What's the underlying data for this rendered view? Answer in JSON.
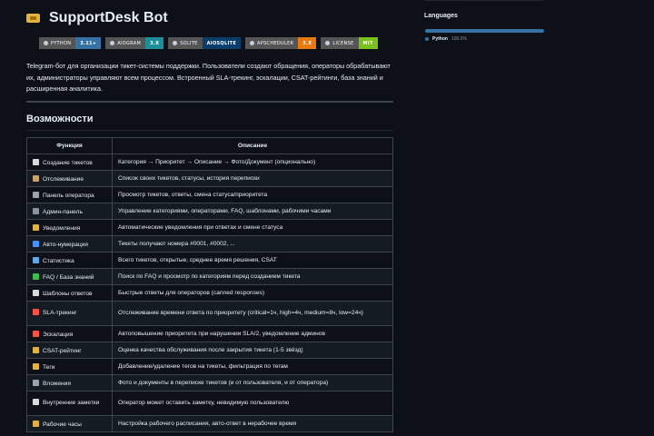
{
  "title": "SupportDesk Bot",
  "badges": [
    {
      "label": "PYTHON",
      "value": "3.11+",
      "color": "#3572A5"
    },
    {
      "label": "AIOGRAM",
      "value": "3.X",
      "color": "#1e8e9a"
    },
    {
      "label": "SQLITE",
      "value": "AIOSQLITE",
      "color": "#0b3d6b"
    },
    {
      "label": "APSCHEDULER",
      "value": "3.X",
      "color": "#e8790f"
    },
    {
      "label": "LICENSE",
      "value": "MIT",
      "color": "#79c11c"
    }
  ],
  "description": "Telegram-бот для организации тикет-системы поддержки. Пользователи создают обращения, операторы обрабатывают их, администраторы управляют всем процессом. Встроенный SLA-трекинг, эскалации, CSAT-рейтинги, база знаний и расширенная аналитика.",
  "features_heading": "Возможности",
  "table": {
    "headers": [
      "Функция",
      "Описание"
    ],
    "rows": [
      {
        "icon": "memo-icon",
        "icon_color": "#d9d9d9",
        "name": "Создание тикетов",
        "desc": "Категория → Приоритет → Описание → Фото/Документ (опционально)"
      },
      {
        "icon": "clipboard-icon",
        "icon_color": "#c9a26b",
        "name": "Отслеживание",
        "desc": "Список своих тикетов, статусы, история переписки"
      },
      {
        "icon": "tools-icon",
        "icon_color": "#9aa4b1",
        "name": "Панель оператора",
        "desc": "Просмотр тикетов, ответы, смена статуса/приоритета"
      },
      {
        "icon": "gear-icon",
        "icon_color": "#8b949e",
        "name": "Админ-панель",
        "desc": "Управление категориями, операторами, FAQ, шаблонами, рабочими часами"
      },
      {
        "icon": "bell-icon",
        "icon_color": "#e3b341",
        "name": "Уведомления",
        "desc": "Автоматические уведомления при ответах и смене статуса"
      },
      {
        "icon": "numbers-icon",
        "icon_color": "#4493f8",
        "name": "Авто-нумерация",
        "desc": "Тикеты получают номера #0001, #0002, ..."
      },
      {
        "icon": "bar-chart-icon",
        "icon_color": "#5fa8e8",
        "name": "Статистика",
        "desc": "Всего тикетов, открытые, среднее время решения, CSAT"
      },
      {
        "icon": "books-icon",
        "icon_color": "#3fb950",
        "name": "FAQ / База знаний",
        "desc": "Поиск по FAQ и просмотр по категориям перед созданием тикета"
      },
      {
        "icon": "page-icon",
        "icon_color": "#d9d9d9",
        "name": "Шаблоны ответов",
        "desc": "Быстрые ответы для операторов (canned responses)"
      },
      {
        "icon": "alarm-icon",
        "icon_color": "#f85149",
        "name": "SLA-трекинг",
        "desc": "Отслеживание времени ответа по приоритету (critical=1ч, high=4ч, medium=8ч, low=24ч)",
        "tall": true
      },
      {
        "icon": "escalation-icon",
        "icon_color": "#f85149",
        "name": "Эскалация",
        "desc": "Автоповышение приоритета при нарушении SLA/2, уведомление админов"
      },
      {
        "icon": "star-icon",
        "icon_color": "#e3b341",
        "name": "CSAT-рейтинг",
        "desc": "Оценка качества обслуживания после закрытия тикета (1-5 звёзд)"
      },
      {
        "icon": "tag-icon",
        "icon_color": "#e3b341",
        "name": "Теги",
        "desc": "Добавление/удаление тегов на тикеты, фильтрация по тегам"
      },
      {
        "icon": "paperclip-icon",
        "icon_color": "#9aa4b1",
        "name": "Вложения",
        "desc": "Фото и документы в переписке тикетов (и от пользователя, и от оператора)"
      },
      {
        "icon": "note-icon",
        "icon_color": "#d9d9d9",
        "name": "Внутренние заметки",
        "desc": "Оператор может оставить заметку, невидимую пользователю",
        "tall": true
      },
      {
        "icon": "clock-icon",
        "icon_color": "#e3b341",
        "name": "Рабочие часы",
        "desc": "Настройка рабочего расписания, авто-ответ в нерабочее время"
      }
    ]
  },
  "sidebar": {
    "languages_heading": "Languages",
    "languages": [
      {
        "name": "Python",
        "percent": "100.0%",
        "color": "#3572A5"
      }
    ]
  }
}
